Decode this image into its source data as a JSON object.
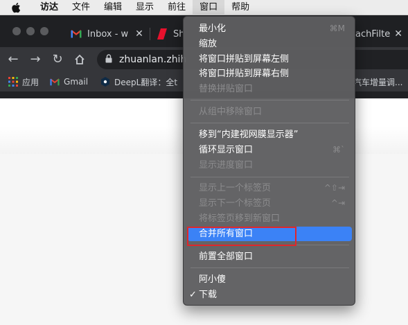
{
  "menubar": {
    "items": [
      {
        "label": "访达"
      },
      {
        "label": "文件"
      },
      {
        "label": "编辑"
      },
      {
        "label": "显示"
      },
      {
        "label": "前往"
      },
      {
        "label": "窗口"
      },
      {
        "label": "帮助"
      }
    ]
  },
  "browser": {
    "tabs": [
      {
        "title": "Inbox - w",
        "favicon": "gmail-icon"
      },
      {
        "title": "Sh",
        "favicon": "red-app-icon"
      },
      {
        "title": "achFilte",
        "favicon": ""
      }
    ],
    "address": "zhuanlan.zhih",
    "bookmarks": [
      {
        "label": "应用",
        "icon": "apps-grid-icon"
      },
      {
        "label": "Gmail",
        "icon": "gmail-icon"
      },
      {
        "label": "DeepL翻译：全t",
        "icon": "deepl-icon"
      },
      {
        "label": "汽车增量调...",
        "icon": ""
      }
    ]
  },
  "window_menu": {
    "items": [
      {
        "label": "最小化",
        "shortcut": "⌘M",
        "disabled": false
      },
      {
        "label": "缩放",
        "shortcut": "",
        "disabled": false
      },
      {
        "label": "将窗口拼贴到屏幕左侧",
        "shortcut": "",
        "disabled": false
      },
      {
        "label": "将窗口拼贴到屏幕右侧",
        "shortcut": "",
        "disabled": false
      },
      {
        "label": "替换拼贴窗口",
        "shortcut": "",
        "disabled": true
      },
      {
        "label": "从组中移除窗口",
        "shortcut": "",
        "disabled": true
      },
      {
        "label": "移到“内建视网膜显示器”",
        "shortcut": "",
        "disabled": false
      },
      {
        "label": "循环显示窗口",
        "shortcut": "⌘`",
        "disabled": false
      },
      {
        "label": "显示进度窗口",
        "shortcut": "",
        "disabled": true
      },
      {
        "label": "显示上一个标签页",
        "shortcut": "^⇧⇥",
        "disabled": true
      },
      {
        "label": "显示下一个标签页",
        "shortcut": "^⇥",
        "disabled": true
      },
      {
        "label": "将标签页移到新窗口",
        "shortcut": "",
        "disabled": true
      },
      {
        "label": "合并所有窗口",
        "shortcut": "",
        "disabled": false,
        "highlighted": true
      },
      {
        "label": "前置全部窗口",
        "shortcut": "",
        "disabled": false
      },
      {
        "label": "阿小傻",
        "shortcut": "",
        "disabled": false
      },
      {
        "label": "下载",
        "shortcut": "",
        "disabled": false,
        "checked": true
      }
    ]
  },
  "colors": {
    "highlight": "#3b82f6",
    "annotation": "#e0262a"
  }
}
